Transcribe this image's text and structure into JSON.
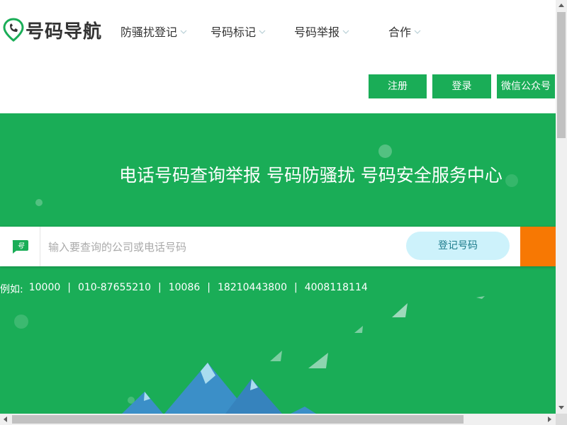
{
  "logo": {
    "text": "号码导航",
    "icon": "phone-pin-icon"
  },
  "nav": [
    {
      "label": "防骚扰登记",
      "has_dropdown": true
    },
    {
      "label": "号码标记",
      "has_dropdown": true
    },
    {
      "label": "号码举报",
      "has_dropdown": true
    },
    {
      "label": "合作",
      "has_dropdown": true
    }
  ],
  "top_buttons": {
    "register": "注册",
    "login": "登录",
    "wechat": "微信公众号"
  },
  "hero": {
    "tagline": "电话号码查询举报 号码防骚扰 号码安全服务中心"
  },
  "search": {
    "icon_label": "号",
    "placeholder": "输入要查询的公司或电话号码",
    "value": "",
    "register_button": "登记号码"
  },
  "examples": {
    "prefix": "例如:",
    "items": [
      "10000",
      "010-87655210",
      "10086",
      "18210443800",
      "4008118114"
    ],
    "separator": "|"
  },
  "colors": {
    "brand_green": "#1aad57",
    "orange": "#f77803",
    "light_cyan": "#cdf2fb"
  }
}
